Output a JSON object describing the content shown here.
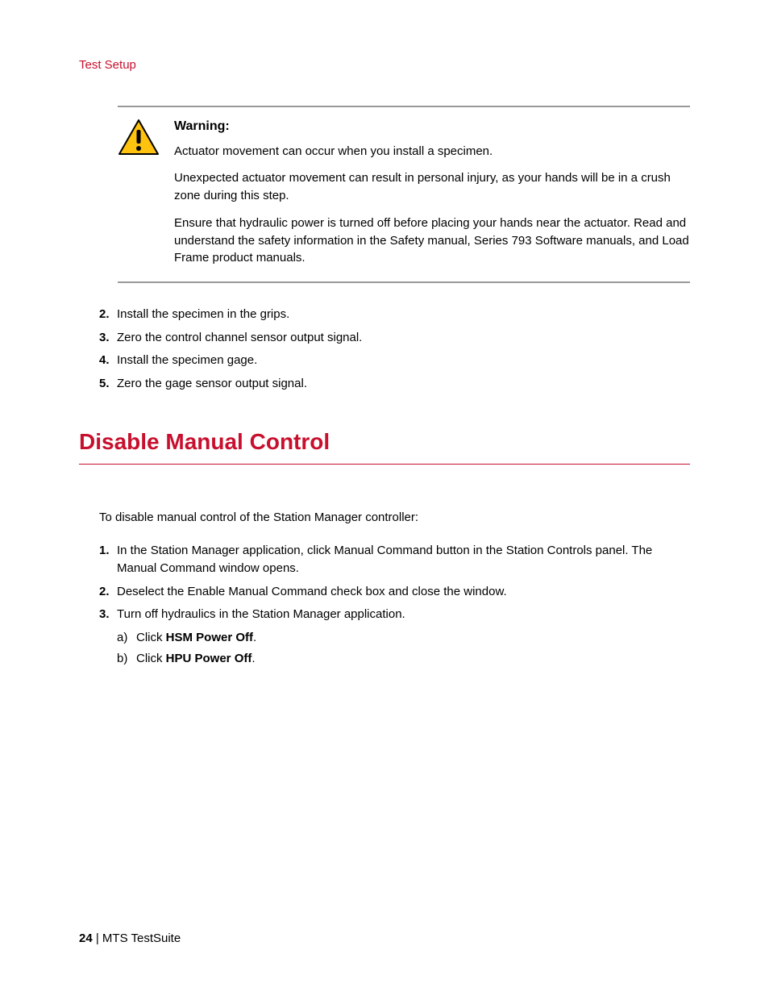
{
  "header": {
    "section_link": "Test Setup"
  },
  "warning": {
    "title": "Warning:",
    "p1": "Actuator movement can occur when you install a specimen.",
    "p2": "Unexpected actuator movement can result in personal injury, as your hands will be in a crush zone during this step.",
    "p3": "Ensure that hydraulic power is turned off before placing your hands near the actuator. Read and understand the safety information in the Safety manual, Series 793 Software manuals, and Load Frame product manuals."
  },
  "steps1": {
    "n2": "2.",
    "t2": "Install the specimen in the grips.",
    "n3": "3.",
    "t3": "Zero the control channel sensor output signal.",
    "n4": "4.",
    "t4": "Install the specimen gage.",
    "n5": "5.",
    "t5": "Zero the gage sensor output signal."
  },
  "section2": {
    "heading": "Disable Manual Control",
    "intro": "To disable manual control of the Station Manager controller:",
    "n1": "1.",
    "t1": "In the Station Manager application, click Manual Command button in the Station Controls panel. The Manual Command window opens.",
    "n2": "2.",
    "t2": "Deselect the Enable Manual Command check box and close the window.",
    "n3": "3.",
    "t3": "Turn off hydraulics in the Station Manager application.",
    "sub_a_marker": "a)",
    "sub_a_prefix": "Click ",
    "sub_a_bold": "HSM Power Off",
    "sub_a_suffix": ".",
    "sub_b_marker": "b)",
    "sub_b_prefix": "Click ",
    "sub_b_bold": "HPU Power Off",
    "sub_b_suffix": "."
  },
  "footer": {
    "page_num": "24",
    "sep": " | ",
    "doc_title": "MTS TestSuite"
  }
}
